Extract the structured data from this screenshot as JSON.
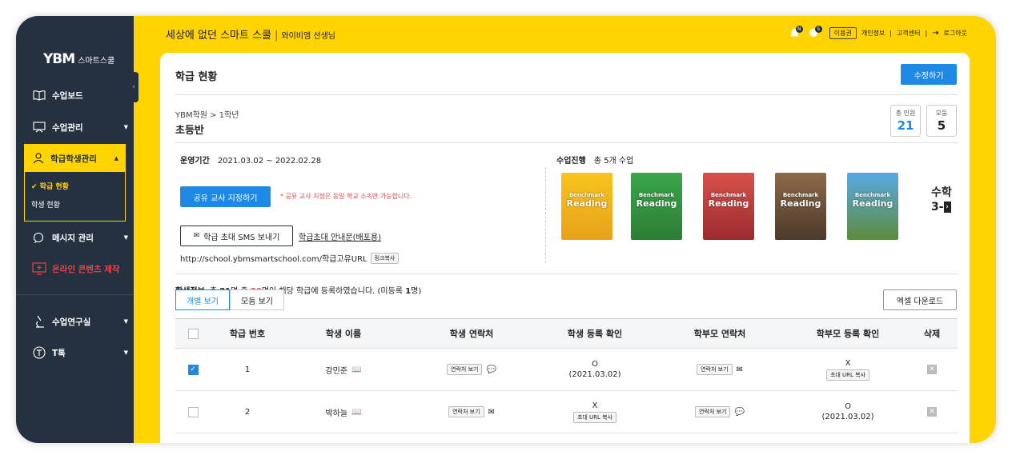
{
  "brand": {
    "logo_mark": "YBM",
    "logo_text": "스마트스쿨"
  },
  "sidebar": {
    "items": [
      {
        "label": "수업보드"
      },
      {
        "label": "수업관리",
        "arrow": "▼"
      },
      {
        "label": "학급학생관리",
        "arrow": "▲"
      },
      {
        "label": "메시지 관리",
        "arrow": "▼"
      },
      {
        "label": "온라인 콘텐츠 제작"
      },
      {
        "label": "수업연구실",
        "arrow": "▼"
      },
      {
        "label": "T톡",
        "arrow": "▼"
      }
    ],
    "sub_items": [
      {
        "label": "✔ 학급 현황"
      },
      {
        "label": "학생 현황"
      }
    ],
    "collapse": "‹"
  },
  "header": {
    "title": "세상에 없던 스마트 스쿨",
    "sep": "|",
    "teacher": "와이비엠 선생님",
    "badges": [
      "N",
      "5"
    ],
    "plan": "이용권",
    "links": [
      "개인정보",
      "고객센터"
    ],
    "logout": "로그아웃"
  },
  "page": {
    "title": "학급 현황",
    "edit_button": "수정하기"
  },
  "class": {
    "breadcrumb": "YBM학원 > 1학년",
    "name": "초등반",
    "total_label": "총 인원",
    "total": "21",
    "group_label": "모둠",
    "group": "5"
  },
  "period": {
    "label": "운영기간",
    "value": "2021.03.02 ~ 2022.02.28"
  },
  "share": {
    "button": "공유 교사 지정하기",
    "note": "* 공유 교사 지정은 동일 학교 소속만 가능합니다."
  },
  "invite": {
    "sms_button": "학급 초대 SMS 보내기",
    "notice_link": "학급초대 안내문(배포용)",
    "url": "http://school.ybmsmartschool.com/학급고유URL",
    "copy_button": "링크복사"
  },
  "progress": {
    "label": "수업진행",
    "value": "총 5개 수업",
    "books": [
      {
        "bm": "Benchmark",
        "rd": "Reading",
        "color": "#f2b31c"
      },
      {
        "bm": "Benchmark",
        "rd": "Reading",
        "color": "#3aa64a"
      },
      {
        "bm": "Benchmark",
        "rd": "Reading",
        "color": "#c8373a"
      },
      {
        "bm": "Benchmark",
        "rd": "Reading",
        "color": "#7a5a3c"
      },
      {
        "bm": "Benchmark",
        "rd": "Reading",
        "color": "#2f86c8"
      }
    ],
    "more_line1": "수학",
    "more_line2": "3-"
  },
  "students": {
    "label": "학생정보",
    "summary_pre": "총 ",
    "total": "21",
    "summary_mid1": "명 중 ",
    "registered": "20",
    "summary_mid2": "명이 해당 학급에 등록하였습니다. (미등록 ",
    "unregistered": "1",
    "summary_post": "명)"
  },
  "tabs": [
    "개별 보기",
    "모둠 보기"
  ],
  "excel_button": "엑셀 다운로드",
  "table": {
    "headers": [
      "학급 번호",
      "학생 이름",
      "학생 연락처",
      "학생 등록 확인",
      "학부모 연락처",
      "학부모 등록 확인",
      "삭제"
    ],
    "rows": [
      {
        "checked": true,
        "no": "1",
        "name": "강민준",
        "contact_btn": "연락처 보기",
        "reg_line1": "O",
        "reg_line2": "(2021.03.02)",
        "parent_btn": "연락처 보기",
        "preg_line1": "X",
        "preg_line2": "초대 URL 복사"
      },
      {
        "checked": false,
        "no": "2",
        "name": "박하늘",
        "contact_btn": "연락처 보기",
        "reg_line1": "X",
        "reg_line2": "초대 URL 복사",
        "parent_btn": "연락처 보기",
        "preg_line1": "O",
        "preg_line2": "(2021.03.02)"
      }
    ]
  }
}
